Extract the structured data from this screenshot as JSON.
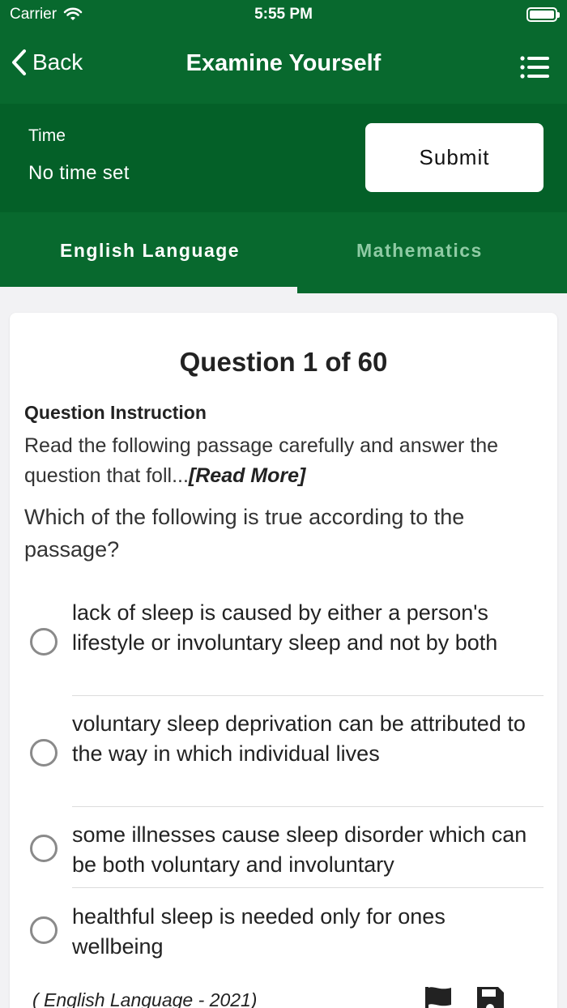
{
  "status_bar": {
    "carrier": "Carrier",
    "time": "5:55 PM",
    "icons": [
      "wifi-icon",
      "battery-icon"
    ]
  },
  "nav": {
    "back_label": "Back",
    "title": "Examine Yourself",
    "menu_icon": "list-icon"
  },
  "timer": {
    "label": "Time",
    "value": "No time set",
    "submit_label": "Submit"
  },
  "tabs": [
    {
      "label": "English Language",
      "selected": true
    },
    {
      "label": "Mathematics",
      "selected": false
    }
  ],
  "question": {
    "number_label": "Question 1 of 60",
    "instruction_label": "Question Instruction",
    "instruction_text": "Read the following passage carefully and answer the question that foll...",
    "read_more": "[Read More]",
    "text": "Which of the following is true according to the passage?",
    "options": [
      {
        "text": "lack of sleep is caused by either a person's lifestyle or involuntary sleep and not by both",
        "selected": false
      },
      {
        "text": "voluntary sleep deprivation can be attributed to the way in which individual lives",
        "selected": false
      },
      {
        "text": "some illnesses cause sleep disorder which can be both voluntary and involuntary",
        "selected": false
      },
      {
        "text": "healthful sleep is needed only for ones wellbeing",
        "selected": false
      }
    ],
    "source": "( English Language - 2021)"
  },
  "colors": {
    "header": "#08692e",
    "timebar": "#046028",
    "tab_inactive": "#8fcba4"
  }
}
